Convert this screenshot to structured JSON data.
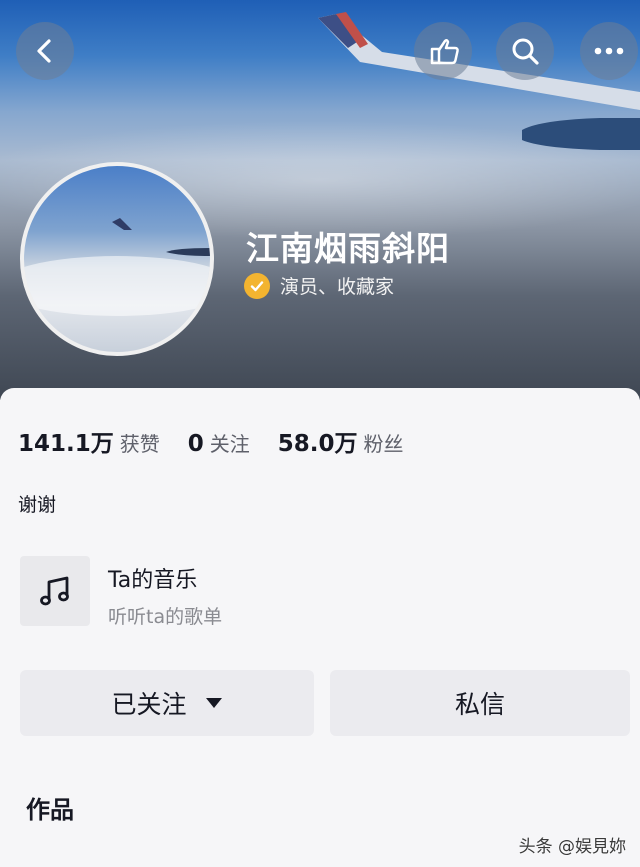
{
  "header": {
    "back_icon": "chevron-left-icon",
    "actions": [
      {
        "name": "gesture-button",
        "icon": "hand-pointer-icon"
      },
      {
        "name": "search-button",
        "icon": "search-icon"
      },
      {
        "name": "more-button",
        "icon": "more-icon"
      }
    ]
  },
  "profile": {
    "name": "江南烟雨斜阳",
    "verification": "演员、收藏家",
    "verify_color": "#f3b430"
  },
  "stats": [
    {
      "value": "141.1万",
      "label": "获赞"
    },
    {
      "value": "0",
      "label": "关注"
    },
    {
      "value": "58.0万",
      "label": "粉丝"
    }
  ],
  "bio": "谢谢",
  "music": {
    "icon": "music-note-icon",
    "title": "Ta的音乐",
    "subtitle": "听听ta的歌单"
  },
  "buttons": {
    "follow_label": "已关注",
    "message_label": "私信"
  },
  "works_title": "作品",
  "watermark": "头条 @娱見妳"
}
